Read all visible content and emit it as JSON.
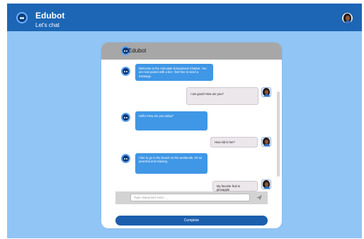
{
  "app": {
    "title": "Edubot",
    "subtitle": "Let's chat"
  },
  "chat": {
    "header_title": "Edubot",
    "messages": [
      {
        "sender": "bot",
        "text": "Welcome to the Articulate Educational Chatbot. You are now paired with a bot - feel free to send a message."
      },
      {
        "sender": "user",
        "text": "I am good! How are you?"
      },
      {
        "sender": "bot",
        "text": "Hello! How are you today?"
      },
      {
        "sender": "user",
        "text": "How old is her?"
      },
      {
        "sender": "bot",
        "text": "I like to go to the beach on the weekends. It's so peaceful and relaxing."
      },
      {
        "sender": "user",
        "text": "My favorite fruit is pineapple"
      }
    ],
    "composer": {
      "placeholder": "Type responses here ...",
      "value": ""
    },
    "complete_label": "Complete"
  },
  "icons": {
    "brand": "robot-avatar-icon",
    "user": "user-avatar-icon",
    "send": "send-icon"
  },
  "colors": {
    "topbar": "#1c66b5",
    "page_background": "#91c5f5",
    "bot_bubble": "#3f97e6",
    "user_bubble": "#ebe7ea",
    "complete_button": "#1c5fae"
  }
}
